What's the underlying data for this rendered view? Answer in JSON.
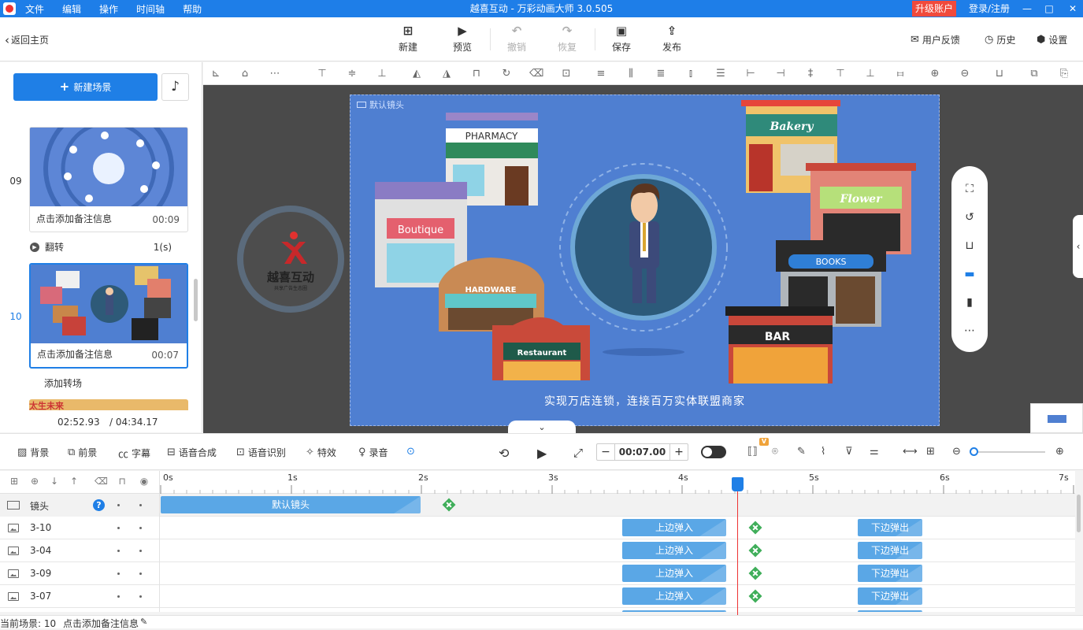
{
  "window": {
    "title": "越喜互动 - 万彩动画大师 3.0.505",
    "menu": [
      "文件",
      "编辑",
      "操作",
      "时间轴",
      "帮助"
    ],
    "upgrade": "升级账户",
    "login": "登录/注册",
    "controls": [
      "—",
      "□",
      "✕"
    ]
  },
  "toolbar": {
    "back": "返回主页",
    "new": "新建",
    "preview": "预览",
    "undo": "撤销",
    "redo": "恢复",
    "save": "保存",
    "publish": "发布",
    "feedback": "用户反馈",
    "history": "历史",
    "settings": "设置"
  },
  "sidebar": {
    "new_scene": "新建场景",
    "scenes": [
      {
        "number": "09",
        "note": "点击添加备注信息",
        "duration": "00:09"
      },
      {
        "number": "10",
        "note": "点击添加备注信息",
        "duration": "00:07"
      }
    ],
    "transition": {
      "name": "翻转",
      "duration": "1(s)"
    },
    "add_transition": "添加转场",
    "next_scene_peek": "太生未来",
    "current_time": "02:52.93",
    "total_time": "/ 04:34.17"
  },
  "stage": {
    "camera_label": "默认镜头",
    "caption": "实现万店连锁，连接百万实体联盟商家",
    "brand_name": "越喜互动",
    "brand_sub": "共享广告生态圈",
    "shops": [
      "PHARMACY",
      "Boutique",
      "HARDWARE",
      "Restaurant",
      "Bakery",
      "Flower",
      "BOOKS",
      "BAR"
    ]
  },
  "timeline": {
    "tools": [
      "背景",
      "前景",
      "字幕",
      "语音合成",
      "语音识别",
      "特效",
      "录音"
    ],
    "current_time": "00:07.00",
    "ruler_labels": [
      "0s",
      "1s",
      "2s",
      "3s",
      "4s",
      "5s",
      "6s",
      "7s"
    ],
    "camera_track": {
      "name": "镜头",
      "block": "默认镜头"
    },
    "tracks": [
      {
        "name": "3-10",
        "enter": "上边弹入",
        "exit": "下边弹出"
      },
      {
        "name": "3-04",
        "enter": "上边弹入",
        "exit": "下边弹出"
      },
      {
        "name": "3-09",
        "enter": "上边弹入",
        "exit": "下边弹出"
      },
      {
        "name": "3-07",
        "enter": "上边弹入",
        "exit": "下边弹出"
      }
    ]
  },
  "status": {
    "current_scene": "当前场景: 10",
    "note": "点击添加备注信息"
  },
  "colors": {
    "accent": "#1e7ee8",
    "stage": "#4f7fd1",
    "block": "#5aa7e6",
    "keyframe": "#3fae5a",
    "playhead": "#e33333"
  }
}
